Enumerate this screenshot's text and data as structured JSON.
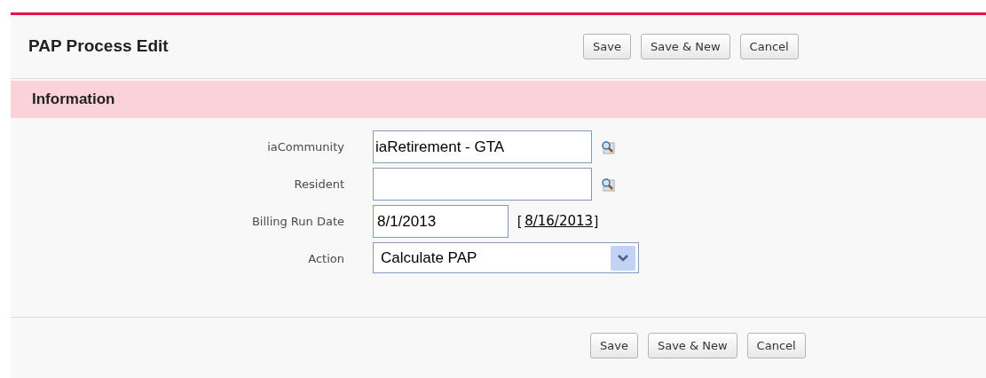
{
  "page_title": "PAP Process Edit",
  "top_buttons": [
    "Save",
    "Save & New",
    "Cancel"
  ],
  "section_title": "Information",
  "fields": [
    {
      "kind": "lookup",
      "label": "iaCommunity",
      "value": "iaRetirement - GTA"
    },
    {
      "kind": "lookup",
      "label": "Resident"
    },
    {
      "kind": "date",
      "label": "Billing Run Date",
      "value": "8/1/2013",
      "bracket_open": "[",
      "today_link": "8/16/2013",
      "bracket_close": "]"
    },
    {
      "kind": "select",
      "label": "Action",
      "value": "Calculate PAP"
    }
  ],
  "bottom_buttons": [
    "Save",
    "Save & New",
    "Cancel"
  ]
}
